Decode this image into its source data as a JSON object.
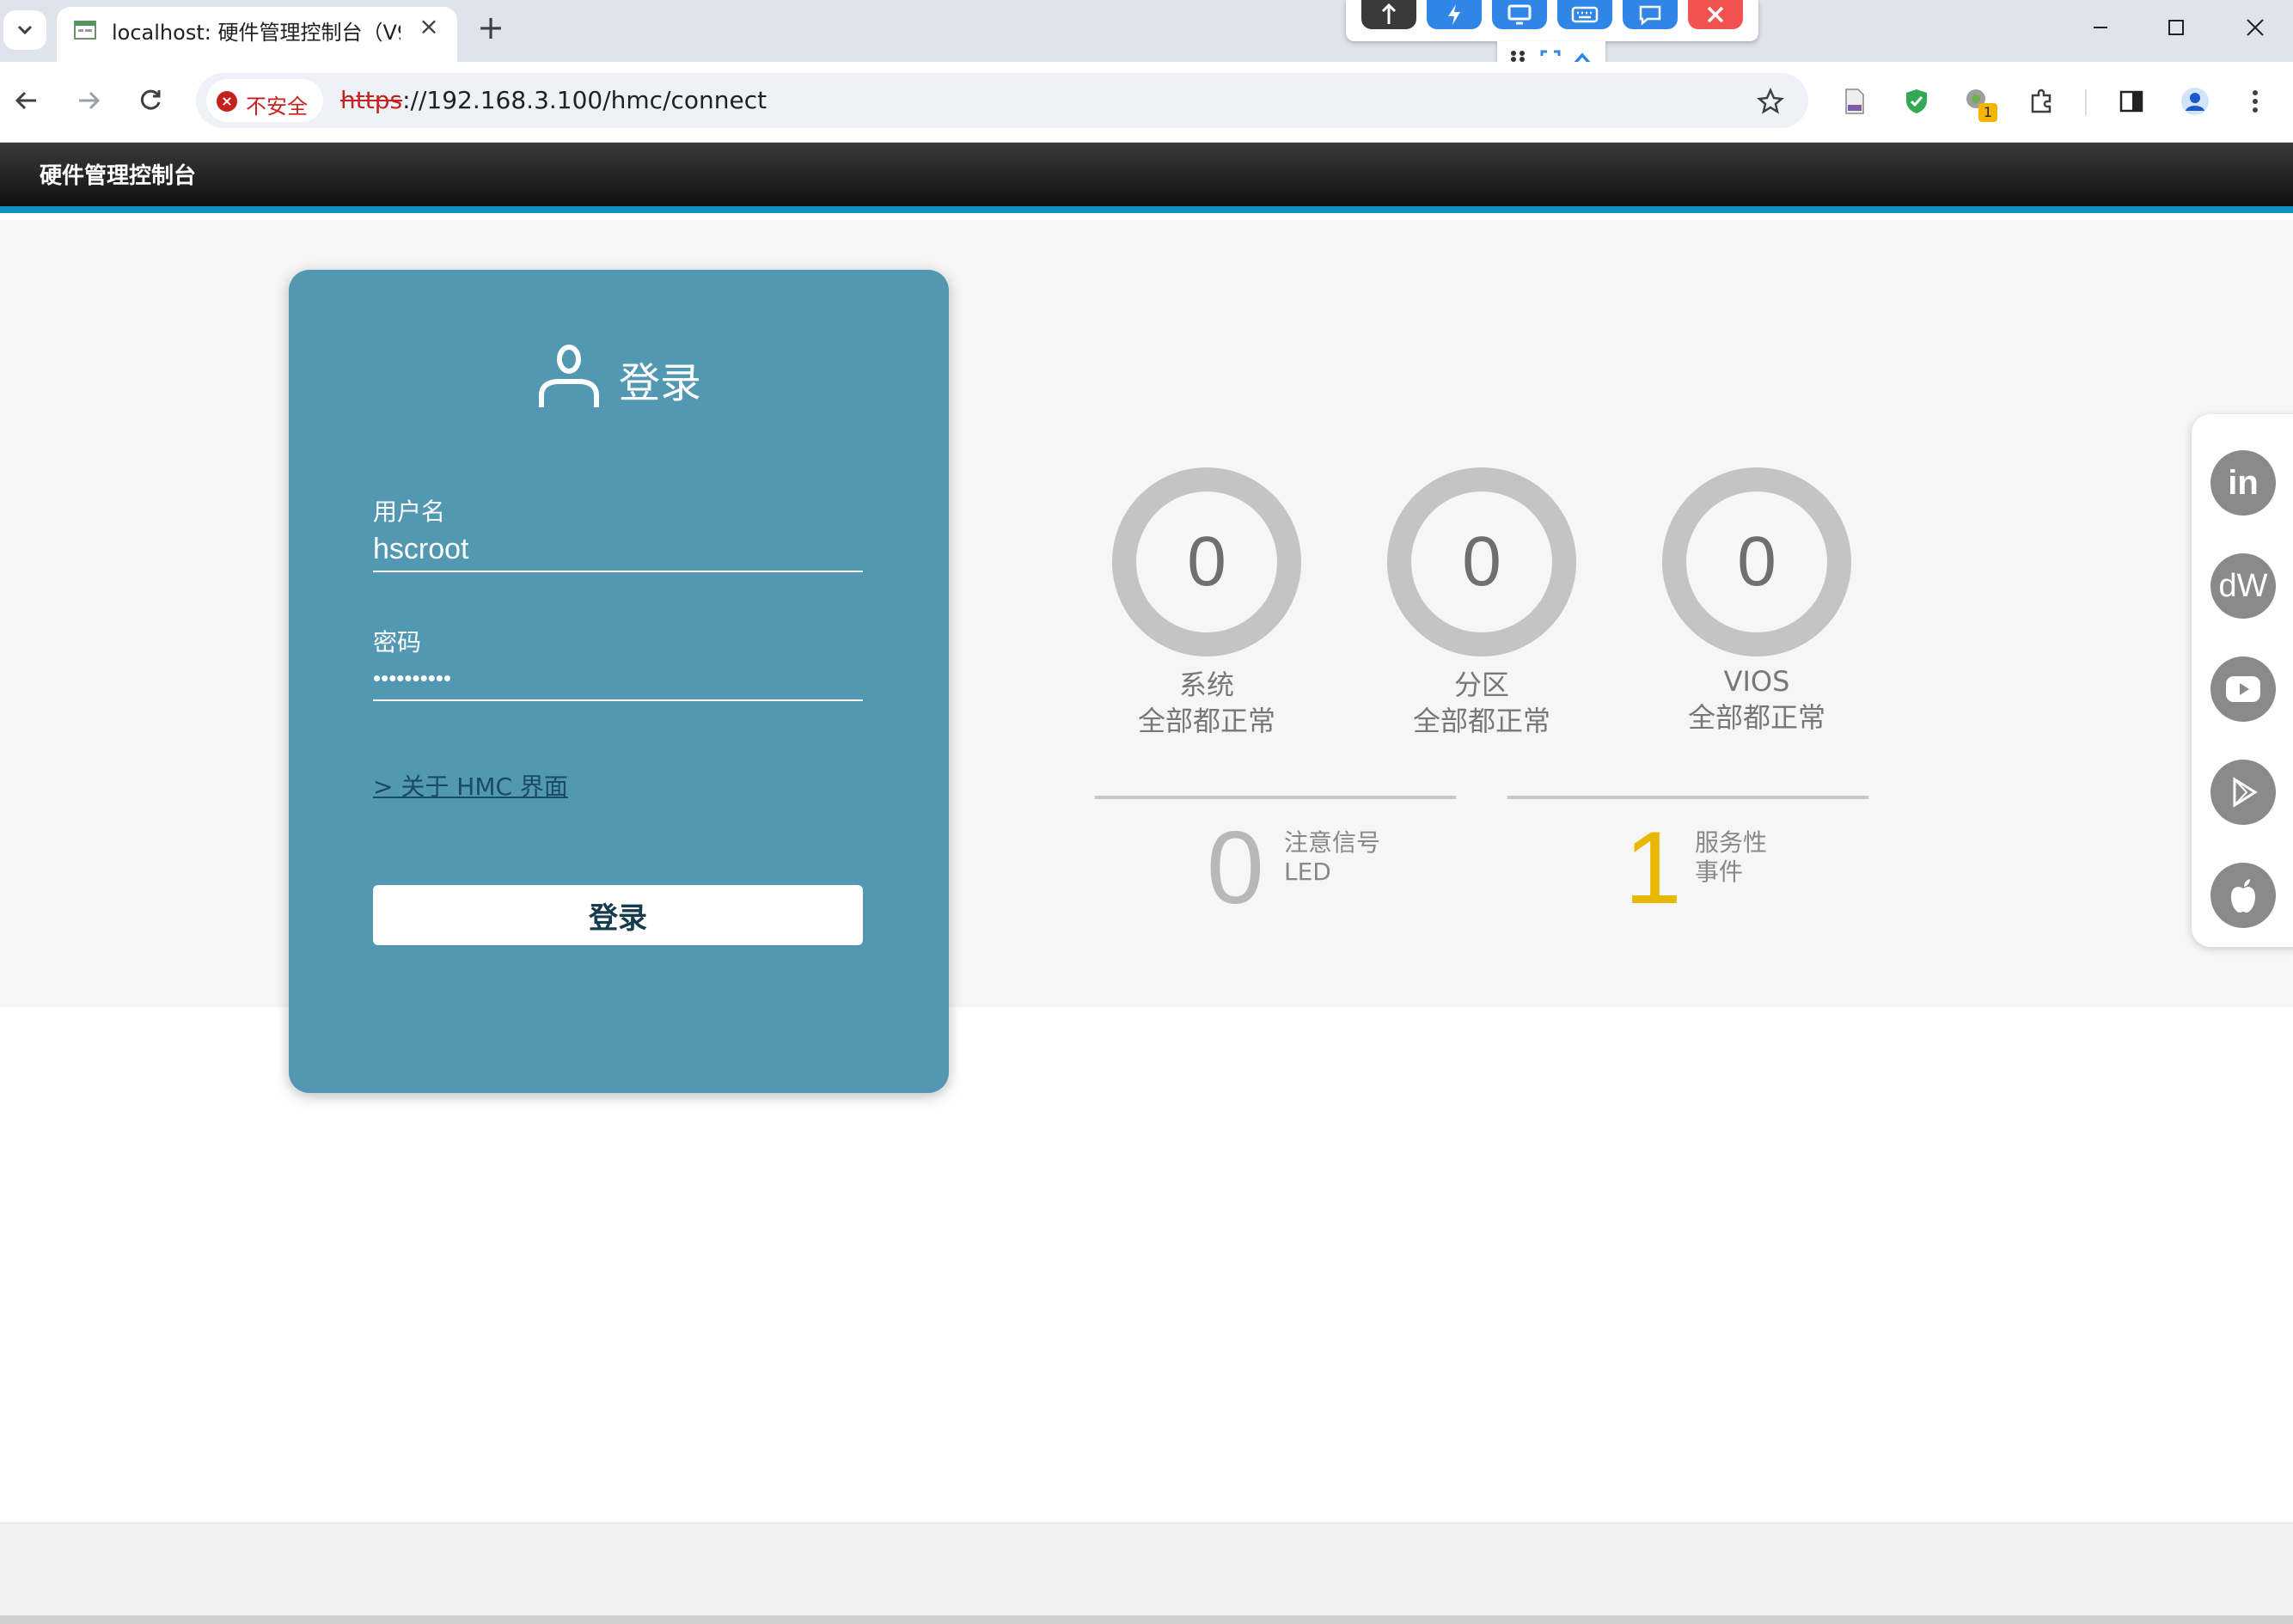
{
  "browser": {
    "tab_title": "localhost: 硬件管理控制台（V9",
    "security_text": "不安全",
    "url_scheme": "https",
    "url_rest": "://192.168.3.100/hmc/connect",
    "ext_badge": "1"
  },
  "header": {
    "title": "硬件管理控制台"
  },
  "login": {
    "title": "登录",
    "username_label": "用户名",
    "username_value": "hscroot",
    "password_label": "密码",
    "password_value": "••••••••••",
    "about_link": "> 关于 HMC 界面",
    "button_label": "登录"
  },
  "status": {
    "rings": [
      {
        "value": "0",
        "name": "系统",
        "state": "全部都正常"
      },
      {
        "value": "0",
        "name": "分区",
        "state": "全部都正常"
      },
      {
        "value": "0",
        "name": "VIOS",
        "state": "全部都正常"
      }
    ],
    "attention": {
      "value": "0",
      "line1": "注意信号",
      "line2": "LED"
    },
    "service": {
      "value": "1",
      "line1": "服务性",
      "line2": "事件"
    }
  },
  "social": [
    {
      "icon": "linkedin-icon",
      "glyph": "in"
    },
    {
      "icon": "developerworks-icon",
      "glyph": "dW"
    },
    {
      "icon": "youtube-icon",
      "glyph": "▶"
    },
    {
      "icon": "play-store-icon",
      "glyph": "▶"
    },
    {
      "icon": "apple-icon",
      "glyph": ""
    }
  ],
  "colors": {
    "card": "#5298b2",
    "header_accent": "#0f8fc2",
    "ring": "#c4c4c4",
    "service_value": "#e8b800",
    "attention_value": "#b8b8b8"
  }
}
